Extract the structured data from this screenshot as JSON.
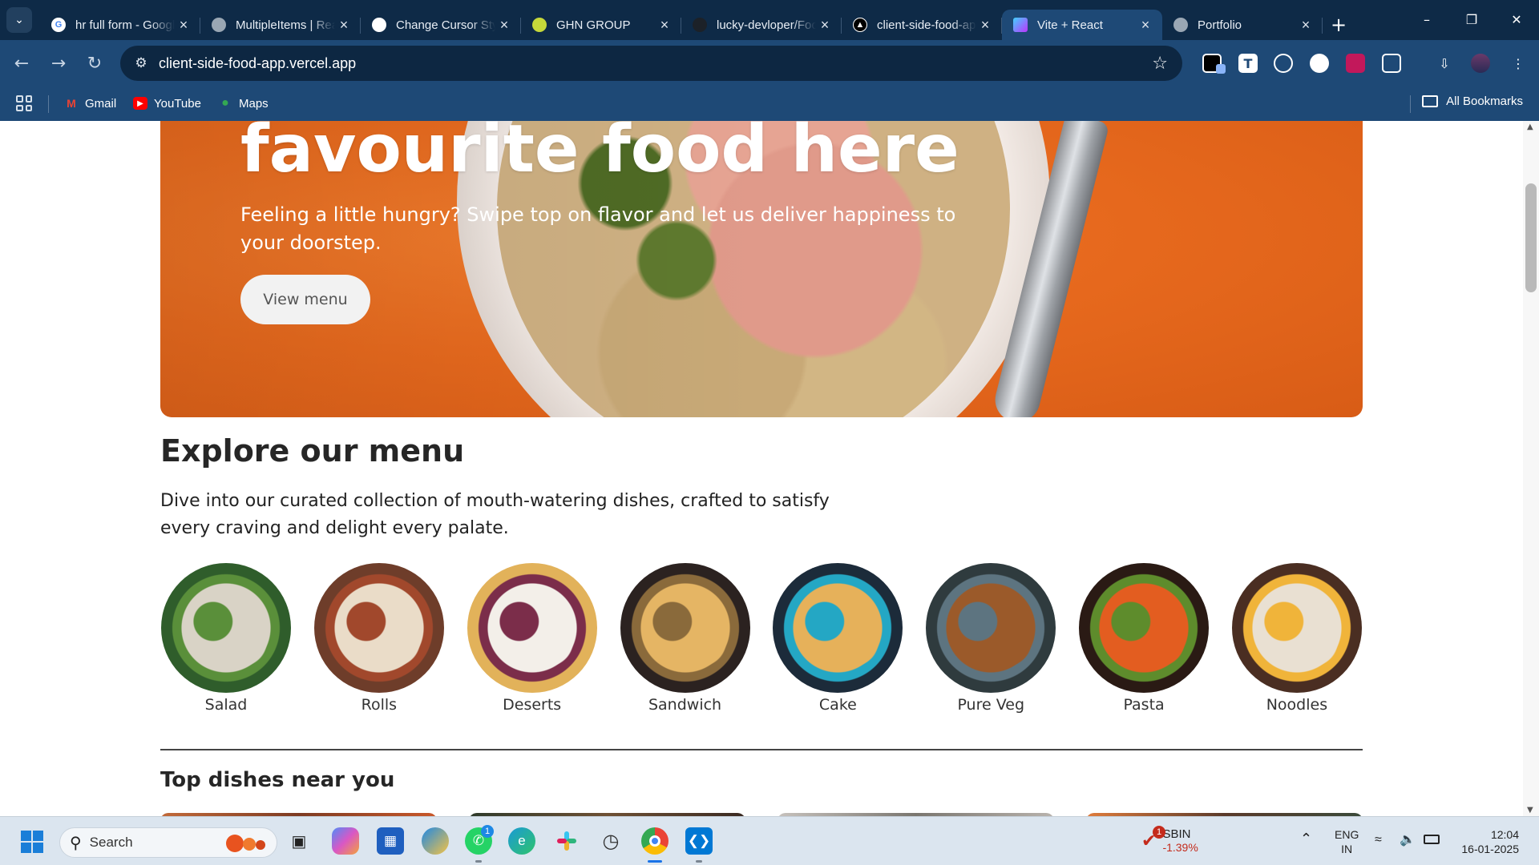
{
  "tabs": [
    {
      "title": "hr full form - Google Search",
      "favicon": "google-g-icon",
      "color": "#ffffff"
    },
    {
      "title": "MultipleItems | React Slick",
      "favicon": "globe-icon",
      "color": "#9aa7b4"
    },
    {
      "title": "Change Cursor Style",
      "favicon": "openai-icon",
      "color": "#ffffff"
    },
    {
      "title": "GHN GROUP",
      "favicon": "ghn-g-icon",
      "color": "#c6d83a"
    },
    {
      "title": "lucky-devloper/Food-App",
      "favicon": "github-icon",
      "color": "#1c2128"
    },
    {
      "title": "client-side-food-app",
      "favicon": "vercel-icon",
      "color": "#000000"
    },
    {
      "title": "Vite + React",
      "favicon": "vite-icon",
      "color": "#a855f7"
    },
    {
      "title": "Portfolio",
      "favicon": "globe-icon",
      "color": "#9aa7b4"
    }
  ],
  "active_tab_index": 6,
  "address_bar": {
    "url": "client-side-food-app.vercel.app"
  },
  "bookmarks": [
    {
      "label": "Gmail",
      "icon": "gmail-icon"
    },
    {
      "label": "YouTube",
      "icon": "youtube-icon"
    },
    {
      "label": "Maps",
      "icon": "maps-icon"
    }
  ],
  "all_bookmarks": "All Bookmarks",
  "hero": {
    "title": "favourite food here",
    "subtitle": "Feeling a little hungry? Swipe top on flavor and let us deliver happiness to your doorstep.",
    "button": "View menu"
  },
  "menu": {
    "title": "Explore our menu",
    "description": "Dive into our curated collection of mouth-watering dishes, crafted to satisfy every craving and delight every palate.",
    "items": [
      {
        "label": "Salad",
        "colors": [
          "#2f5d2b",
          "#d9d3c6",
          "#5a8f3a"
        ]
      },
      {
        "label": "Rolls",
        "colors": [
          "#6e3d2a",
          "#eadcc8",
          "#a1482c"
        ]
      },
      {
        "label": "Deserts",
        "colors": [
          "#e2b25a",
          "#f3efe9",
          "#7b2d4a"
        ]
      },
      {
        "label": "Sandwich",
        "colors": [
          "#2b2220",
          "#e5b564",
          "#8a6a3b"
        ]
      },
      {
        "label": "Cake",
        "colors": [
          "#1c2b3a",
          "#e6b15a",
          "#24a7c4"
        ]
      },
      {
        "label": "Pure Veg",
        "colors": [
          "#2f3b3e",
          "#9b5a2a",
          "#5d7480"
        ]
      },
      {
        "label": "Pasta",
        "colors": [
          "#2a1a14",
          "#e35d20",
          "#5e8c2c"
        ]
      },
      {
        "label": "Noodles",
        "colors": [
          "#4a2e22",
          "#e9e0d2",
          "#f0b43a"
        ]
      }
    ]
  },
  "top_dishes": {
    "title": "Top dishes near you"
  },
  "taskbar": {
    "search_placeholder": "Search",
    "whatsapp_badge": "1",
    "stock_badge": "1",
    "stock_symbol": "SBIN",
    "stock_change": "-1.39%",
    "lang_top": "ENG",
    "lang_bottom": "IN",
    "time": "12:04",
    "date": "16-01-2025"
  }
}
